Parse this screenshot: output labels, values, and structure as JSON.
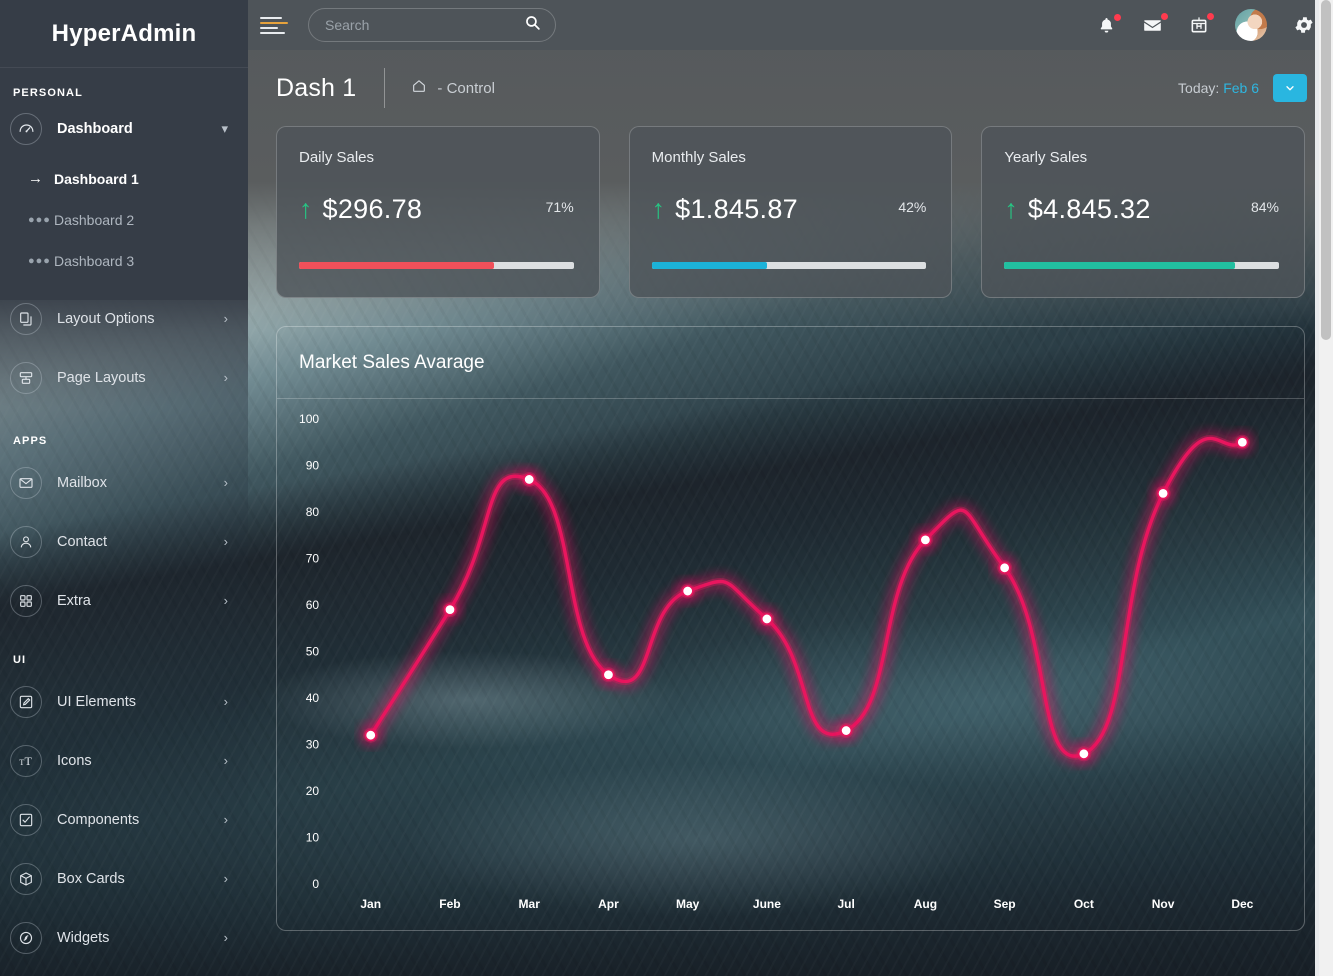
{
  "brand": {
    "name": "HyperAdmin"
  },
  "topbar": {
    "hamburger_icon": "menu-icon",
    "search": {
      "placeholder": "Search",
      "value": "",
      "icon": "search-icon"
    },
    "icons": [
      {
        "name": "bell-icon",
        "badge": true
      },
      {
        "name": "envelope-icon",
        "badge": true
      },
      {
        "name": "gift-box-icon",
        "badge": true
      }
    ],
    "avatar": "user-avatar",
    "settings_icon": "gear-icon"
  },
  "sidebar": {
    "sections": [
      {
        "title": "PERSONAL",
        "items": [
          {
            "label": "Dashboard",
            "icon": "speedometer-icon",
            "chevron": "chevron-down",
            "expanded": true,
            "children": [
              {
                "label": "Dashboard 1",
                "marker": "arrow-right",
                "active": true
              },
              {
                "label": "Dashboard 2",
                "marker": "dots",
                "active": false
              },
              {
                "label": "Dashboard 3",
                "marker": "dots",
                "active": false
              }
            ]
          },
          {
            "label": "Layout Options",
            "icon": "copy-icon",
            "chevron": "chevron-right"
          },
          {
            "label": "Page Layouts",
            "icon": "layout-icon",
            "chevron": "chevron-right"
          }
        ]
      },
      {
        "title": "APPS",
        "items": [
          {
            "label": "Mailbox",
            "icon": "envelope-icon",
            "chevron": "chevron-right"
          },
          {
            "label": "Contact",
            "icon": "user-icon",
            "chevron": "chevron-right"
          },
          {
            "label": "Extra",
            "icon": "grid-icon",
            "chevron": "chevron-right"
          }
        ]
      },
      {
        "title": "UI",
        "items": [
          {
            "label": "UI Elements",
            "icon": "pencil-square-icon",
            "chevron": "chevron-right"
          },
          {
            "label": "Icons",
            "icon": "typography-icon",
            "chevron": "chevron-right"
          },
          {
            "label": "Components",
            "icon": "check-square-icon",
            "chevron": "chevron-right"
          },
          {
            "label": "Box Cards",
            "icon": "box-icon",
            "chevron": "chevron-right"
          },
          {
            "label": "Widgets",
            "icon": "widget-icon",
            "chevron": "chevron-right"
          }
        ]
      }
    ]
  },
  "page": {
    "title": "Dash 1",
    "breadcrumb": {
      "home_icon": "home-icon",
      "text": "-  Control"
    },
    "today_label": "Today:",
    "today_value": "Feb 6",
    "today_button_icon": "chevron-down-icon"
  },
  "cards": [
    {
      "title": "Daily Sales",
      "trend_icon": "arrow-up-icon",
      "amount": "$296.78",
      "percent": "71%",
      "progress": 71,
      "color": "#f0505a"
    },
    {
      "title": "Monthly Sales",
      "trend_icon": "arrow-up-icon",
      "amount": "$1.845.87",
      "percent": "42%",
      "progress": 42,
      "color": "#1cb2d8"
    },
    {
      "title": "Yearly Sales",
      "trend_icon": "arrow-up-icon",
      "amount": "$4.845.32",
      "percent": "84%",
      "progress": 84,
      "color": "#22bfa0"
    }
  ],
  "chart_panel": {
    "title": "Market Sales Avarage"
  },
  "chart_data": {
    "type": "line",
    "title": "Market Sales Avarage",
    "xlabel": "",
    "ylabel": "",
    "categories": [
      "Jan",
      "Feb",
      "Mar",
      "Apr",
      "May",
      "June",
      "Jul",
      "Aug",
      "Sep",
      "Oct",
      "Nov",
      "Dec"
    ],
    "series": [
      {
        "name": "Market Sales Avarage",
        "values": [
          32,
          59,
          87,
          45,
          63,
          57,
          33,
          74,
          68,
          28,
          84,
          95
        ],
        "color": "#e8165e"
      }
    ],
    "ylim": [
      0,
      100
    ],
    "yticks": [
      0,
      10,
      20,
      30,
      40,
      50,
      60,
      70,
      80,
      90,
      100
    ],
    "grid": false,
    "legend": "none",
    "marker_color": "#ffffff",
    "stem_color": "rgba(235,240,244,0.80)",
    "smoothing": "spline"
  }
}
